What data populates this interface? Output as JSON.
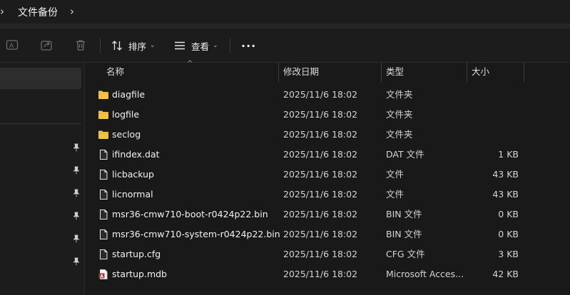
{
  "breadcrumb": {
    "title": "文件备份"
  },
  "toolbar": {
    "sort_label": "排序",
    "view_label": "查看",
    "more_label": "···"
  },
  "columns": {
    "name": "名称",
    "modified": "修改日期",
    "type": "类型",
    "size": "大小"
  },
  "colors": {
    "folder": "#f4c04d",
    "background": "#191919",
    "selected_nav": "#2d2d2d"
  },
  "files": [
    {
      "name": "diagfile",
      "date": "2025/11/6 18:02",
      "type": "文件夹",
      "size": "",
      "icon": "folder-icon"
    },
    {
      "name": "logfile",
      "date": "2025/11/6 18:02",
      "type": "文件夹",
      "size": "",
      "icon": "folder-icon"
    },
    {
      "name": "seclog",
      "date": "2025/11/6 18:02",
      "type": "文件夹",
      "size": "",
      "icon": "folder-icon"
    },
    {
      "name": "ifindex.dat",
      "date": "2025/11/6 18:02",
      "type": "DAT 文件",
      "size": "1 KB",
      "icon": "file-icon"
    },
    {
      "name": "licbackup",
      "date": "2025/11/6 18:02",
      "type": "文件",
      "size": "43 KB",
      "icon": "file-icon"
    },
    {
      "name": "licnormal",
      "date": "2025/11/6 18:02",
      "type": "文件",
      "size": "43 KB",
      "icon": "file-icon"
    },
    {
      "name": "msr36-cmw710-boot-r0424p22.bin",
      "date": "2025/11/6 18:02",
      "type": "BIN 文件",
      "size": "0 KB",
      "icon": "file-icon"
    },
    {
      "name": "msr36-cmw710-system-r0424p22.bin",
      "date": "2025/11/6 18:02",
      "type": "BIN 文件",
      "size": "0 KB",
      "icon": "file-icon"
    },
    {
      "name": "startup.cfg",
      "date": "2025/11/6 18:02",
      "type": "CFG 文件",
      "size": "3 KB",
      "icon": "file-icon"
    },
    {
      "name": "startup.mdb",
      "date": "2025/11/6 18:02",
      "type": "Microsoft Acces...",
      "size": "42 KB",
      "icon": "access-db-icon"
    }
  ]
}
